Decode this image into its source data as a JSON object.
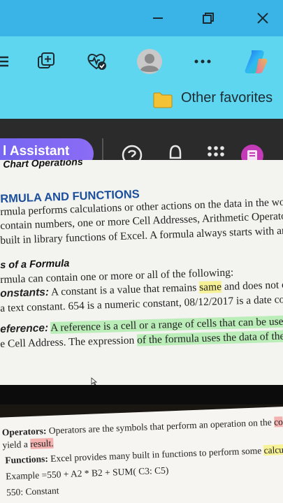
{
  "favorites_bar": {
    "folder_label": "Other favorites"
  },
  "app_bar": {
    "assistant_label": "l Assistant"
  },
  "document": {
    "top_cut": "Chart Operations",
    "heading": "RMULA AND FUNCTIONS",
    "para1": [
      "rmula performs calculations or other actions on the data in the work",
      "contain numbers, one or more Cell Addresses, Arithmetic Operators,",
      "built in library functions of Excel. A formula always starts with an e"
    ],
    "subheading": "s of a Formula",
    "para2_intro": "rmula can contain one or more or all of the following:",
    "constants": {
      "label": "onstants:",
      "text_a": " A constant is a value that remains ",
      "highlight": "same",
      "text_b": " and does not cha",
      "line2": "a text constant. 654 is a numeric constant, 08/12/2017 is a date co"
    },
    "reference": {
      "label": "eference:",
      "text_a": " ",
      "highlight": "A reference is a cell or a range of cells that can be used in t",
      "line2_a": "e Cell Address. The expression ",
      "line2_hl": "of the formula uses the data of the r"
    }
  },
  "page2": {
    "operators": {
      "label": "Operators:",
      "text": " Operators are the symbols that perform an operation on the ",
      "hl": "co",
      "line2_a": "yield a ",
      "line2_hl": "result."
    },
    "functions": {
      "label": "Functions:",
      "text": " Excel provides many built in functions to perform some ",
      "hl": "calcu"
    },
    "example": "Example =550 + A2 * B2 + SUM( C3: C5)",
    "constant_line": "550: Constant"
  }
}
